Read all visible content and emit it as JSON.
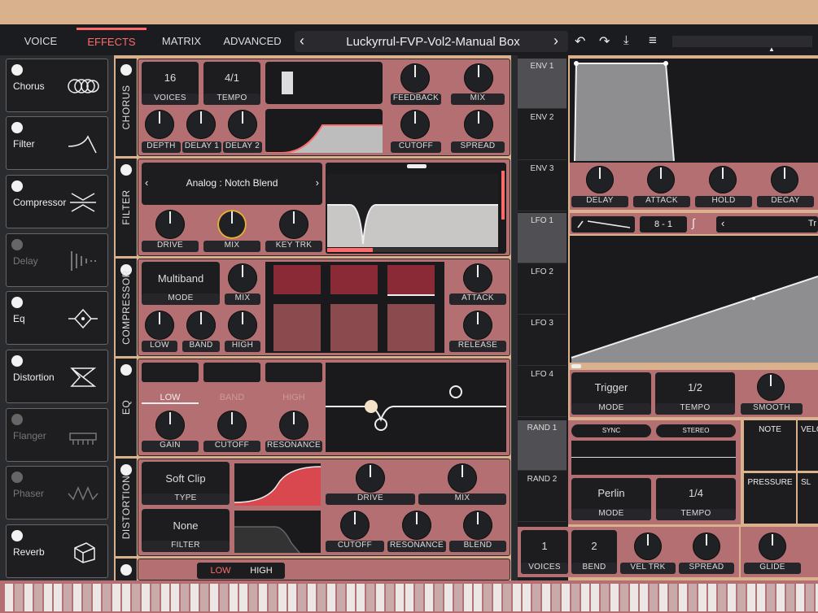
{
  "tabs": [
    {
      "label": "VOICE"
    },
    {
      "label": "EFFECTS"
    },
    {
      "label": "MATRIX"
    },
    {
      "label": "ADVANCED"
    }
  ],
  "preset": {
    "name": "Luckyrrul-FVP-Vol2-Manual Box"
  },
  "sidebar": {
    "items": [
      {
        "label": "Chorus",
        "on": true
      },
      {
        "label": "Filter",
        "on": true
      },
      {
        "label": "Compressor",
        "on": true
      },
      {
        "label": "Delay",
        "on": false
      },
      {
        "label": "Eq",
        "on": true
      },
      {
        "label": "Distortion",
        "on": true
      },
      {
        "label": "Flanger",
        "on": false
      },
      {
        "label": "Phaser",
        "on": false
      },
      {
        "label": "Reverb",
        "on": true
      }
    ]
  },
  "chorus": {
    "title": "CHORUS",
    "voices_value": "16",
    "voices_label": "VOICES",
    "tempo_value": "4/1",
    "tempo_label": "TEMPO",
    "feedback": "FEEDBACK",
    "mix": "MIX",
    "depth": "DEPTH",
    "delay1": "DELAY 1",
    "delay2": "DELAY 2",
    "cutoff": "CUTOFF",
    "spread": "SPREAD"
  },
  "filter": {
    "title": "FILTER",
    "model": "Analog : Notch Blend",
    "drive": "DRIVE",
    "mix": "MIX",
    "keytrk": "KEY TRK"
  },
  "compressor": {
    "title": "COMPRESSOR",
    "mode_value": "Multiband",
    "mode_label": "MODE",
    "mix": "MIX",
    "low": "LOW",
    "band": "BAND",
    "high": "HIGH",
    "attack": "ATTACK",
    "release": "RELEASE"
  },
  "eq": {
    "title": "EQ",
    "low": "LOW",
    "band": "BAND",
    "high": "HIGH",
    "gain": "GAIN",
    "cutoff": "CUTOFF",
    "resonance": "RESONANCE"
  },
  "distortion": {
    "title": "DISTORTION",
    "type_value": "Soft Clip",
    "type_label": "TYPE",
    "filter_value": "None",
    "filter_label": "FILTER",
    "drive": "DRIVE",
    "mix": "MIX",
    "cutoff": "CUTOFF",
    "resonance": "RESONANCE",
    "blend": "BLEND"
  },
  "bottom_strip": {
    "low": "LOW",
    "high": "HIGH"
  },
  "env": {
    "rows": [
      "ENV 1",
      "ENV 2",
      "ENV 3"
    ],
    "delay": "DELAY",
    "attack": "ATTACK",
    "hold": "HOLD",
    "decay": "DECAY"
  },
  "lfo": {
    "rows": [
      "LFO 1",
      "LFO 2",
      "LFO 3",
      "LFO 4"
    ],
    "steps": "8 - 1",
    "mode_value": "Trigger",
    "mode_label": "MODE",
    "tempo_value": "1/2",
    "tempo_label": "TEMPO",
    "smooth": "SMOOTH",
    "preset_partial": "Tr"
  },
  "rand": {
    "rows": [
      "RAND 1",
      "RAND 2"
    ],
    "sync": "SYNC",
    "stereo": "STEREO",
    "mode_value": "Perlin",
    "mode_label": "MODE",
    "tempo_value": "1/4",
    "tempo_label": "TEMPO",
    "note": "NOTE",
    "velo": "VELO",
    "pressure": "PRESSURE",
    "sl": "SL"
  },
  "voice": {
    "voices_value": "1",
    "voices_label": "VOICES",
    "bend_value": "2",
    "bend_label": "BEND",
    "veltrk": "VEL TRK",
    "spread": "SPREAD",
    "glide": "GLIDE"
  },
  "colors": {
    "accent": "#ff6b6b",
    "panel": "#b46f72",
    "dark": "#18191b",
    "knob_ring": "#e8b03a"
  }
}
